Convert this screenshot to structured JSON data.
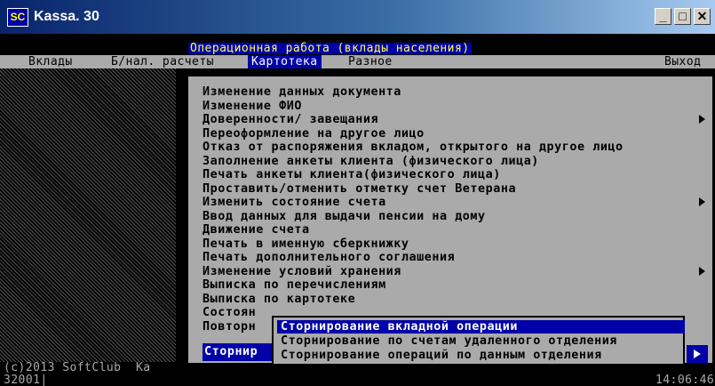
{
  "window": {
    "title": "Kassa. 30",
    "icon_label": "SC",
    "buttons": {
      "minimize": "_",
      "maximize": "□",
      "close": "✕"
    }
  },
  "screen_header": "Операционная работа (вклады населения)",
  "menubar": {
    "items": [
      "Вклады",
      "Б/нал. расчеты",
      "Картотека",
      "Разное"
    ],
    "exit": "Выход",
    "active": "Картотека"
  },
  "dropdown": {
    "items": [
      {
        "label": "Изменение данных документа",
        "has_submenu": false
      },
      {
        "label": "Изменение ФИО",
        "has_submenu": false
      },
      {
        "label": "Доверенности/ завещания",
        "has_submenu": true
      },
      {
        "label": "Переоформление на другое лицо",
        "has_submenu": false
      },
      {
        "label": "Отказ от распоряжения вкладом, открытого на другое лицо",
        "has_submenu": false
      },
      {
        "label": "Заполнение анкеты клиента (физического лица)",
        "has_submenu": false
      },
      {
        "label": "Печать анкеты клиента(физического лица)",
        "has_submenu": false
      },
      {
        "label": "Проставить/отменить отметку счет Ветерана",
        "has_submenu": false
      },
      {
        "label": "Изменить состояние счета",
        "has_submenu": true
      },
      {
        "label": "Ввод данных для выдачи пенсии на дому",
        "has_submenu": false
      },
      {
        "label": "Движение счета",
        "has_submenu": false
      },
      {
        "label": "Печать в именную сберкнижку",
        "has_submenu": false
      },
      {
        "label": "Печать дополнительного соглашения",
        "has_submenu": false
      },
      {
        "label": "Изменение условий хранения",
        "has_submenu": true
      },
      {
        "label": "Выписка по перечислениям",
        "has_submenu": false
      },
      {
        "label": "Выписка по картотеке",
        "has_submenu": false
      },
      {
        "label": "Состоян",
        "has_submenu": false
      },
      {
        "label": "Повторн",
        "has_submenu": false
      }
    ],
    "selected_truncated": "Сторнир"
  },
  "submenu": {
    "items": [
      "Сторнирование вкладной операции",
      "Сторнирование по счетам удаленного отделения",
      "Сторнирование операций по данным отделения"
    ],
    "selected_index": 0
  },
  "status": {
    "copyright": "(c)2013 SoftClub  Ka",
    "code": "32001|",
    "time": "14:06:46"
  },
  "colors": {
    "title_bar": "#08246b",
    "console_gray": "#aaaaaa",
    "highlight_blue": "#0000a8",
    "header_yellow": "#ffff55"
  }
}
